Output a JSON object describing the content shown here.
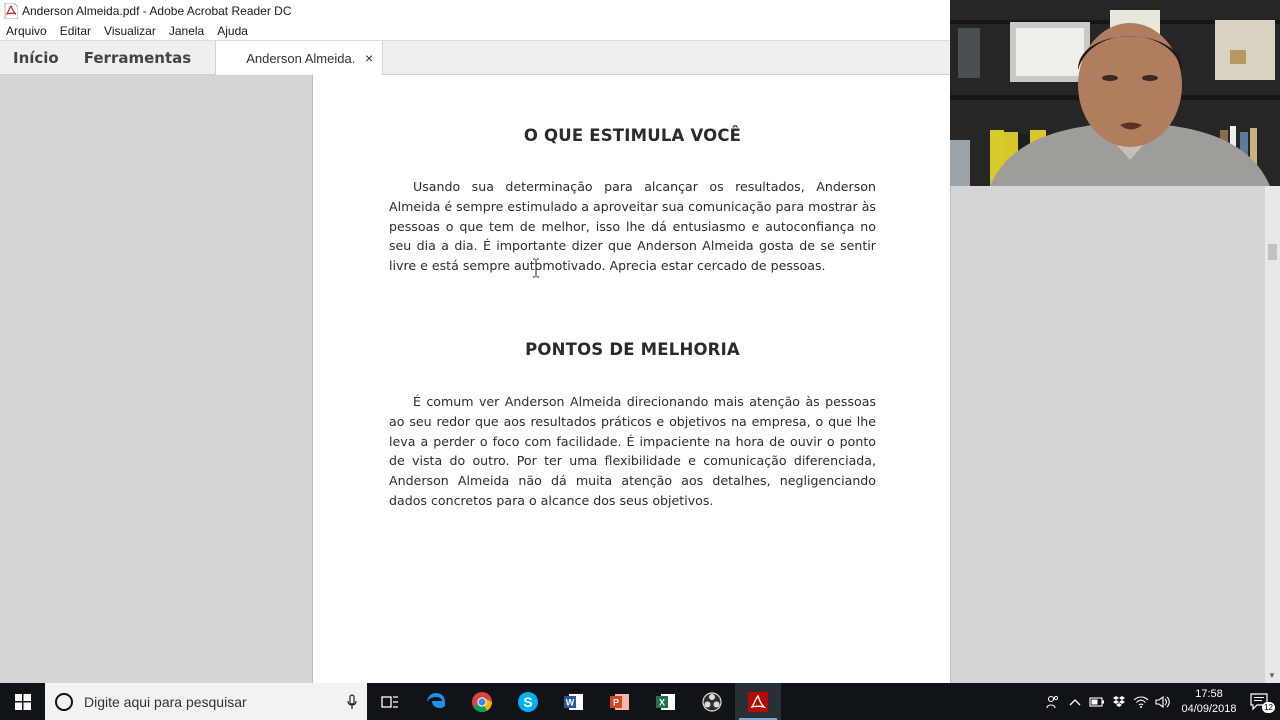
{
  "window": {
    "title": "Anderson Almeida.pdf - Adobe Acrobat Reader DC"
  },
  "menu": [
    "Arquivo",
    "Editar",
    "Visualizar",
    "Janela",
    "Ajuda"
  ],
  "tabs": {
    "home": "Início",
    "tools": "Ferramentas",
    "document": "Anderson Almeida.",
    "close": "×"
  },
  "document": {
    "section1_title": "O QUE ESTIMULA VOCÊ",
    "section1_text": "Usando sua determinação para alcançar os resultados, Anderson Almeida é sempre estimulado a aproveitar sua comunicação para mostrar às pessoas o que tem de melhor, isso lhe dá entusiasmo e autoconfiança no seu dia a dia. É importante dizer que Anderson Almeida gosta de se sentir livre e está sempre automotivado. Aprecia estar cercado de pessoas.",
    "section2_title": "PONTOS DE MELHORIA",
    "section2_text": "É comum ver Anderson Almeida direcionando mais atenção às pessoas ao seu redor que aos resultados práticos e objetivos na empresa, o que lhe leva a perder o foco com facilidade. É impaciente na hora de ouvir o ponto de vista do outro. Por ter uma flexibilidade e comunicação diferenciada, Anderson Almeida não dá muita atenção aos detalhes, negligenciando dados concretos para o alcance dos seus objetivos."
  },
  "taskbar": {
    "search_placeholder": "Digite aqui para pesquisar",
    "apps": [
      "task-view",
      "edge",
      "chrome",
      "skype",
      "word",
      "powerpoint",
      "excel",
      "obs",
      "acrobat"
    ],
    "time": "17:58",
    "date": "04/09/2018",
    "notification_count": "12"
  }
}
